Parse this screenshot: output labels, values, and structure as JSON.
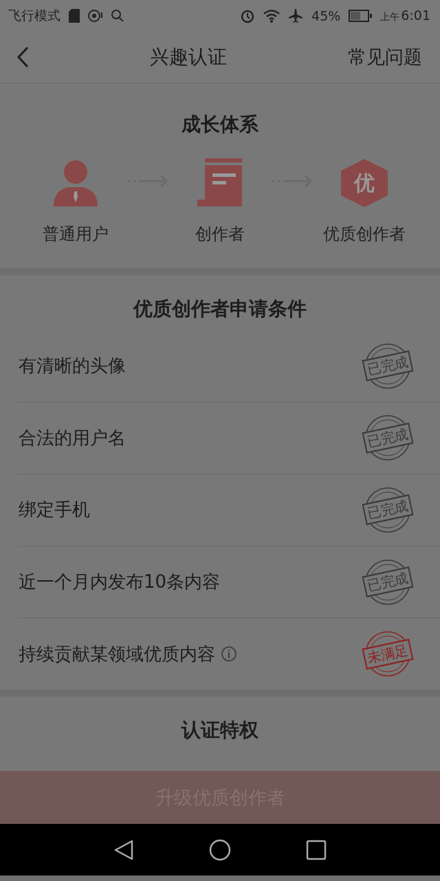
{
  "status_bar": {
    "mode": "飞行模式",
    "battery": "45%",
    "time_prefix": "上午",
    "time": "6:01"
  },
  "header": {
    "title": "兴趣认证",
    "action": "常见问题"
  },
  "growth": {
    "title": "成长体系",
    "steps": [
      {
        "kind": "user",
        "label": "普通用户"
      },
      {
        "kind": "document",
        "label": "创作者"
      },
      {
        "kind": "badge",
        "label": "优质创作者",
        "badge_text": "优"
      }
    ]
  },
  "conditions": {
    "title": "优质创作者申请条件",
    "items": [
      {
        "text": "有清晰的头像",
        "met": true,
        "stamp": "已完成",
        "info": false
      },
      {
        "text": "合法的用户名",
        "met": true,
        "stamp": "已完成",
        "info": false
      },
      {
        "text": "绑定手机",
        "met": true,
        "stamp": "已完成",
        "info": false
      },
      {
        "text": "近一个月内发布10条内容",
        "met": true,
        "stamp": "已完成",
        "info": false
      },
      {
        "text": "持续贡献某领域优质内容",
        "met": false,
        "stamp": "未满足",
        "info": true
      }
    ]
  },
  "privileges": {
    "title": "认证特权"
  },
  "upgrade_button": {
    "label": "升级优质创作者",
    "disabled": true
  }
}
